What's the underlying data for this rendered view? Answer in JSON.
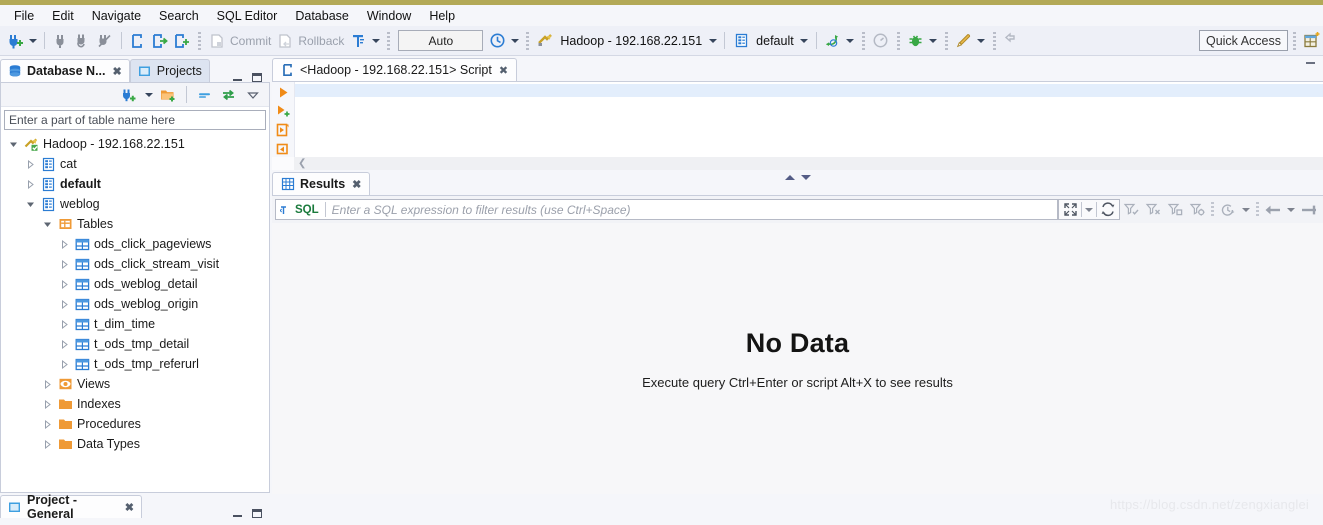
{
  "app": {
    "menu": [
      "File",
      "Edit",
      "Navigate",
      "Search",
      "SQL Editor",
      "Database",
      "Window",
      "Help"
    ]
  },
  "toolbar": {
    "commit_label": "Commit",
    "rollback_label": "Rollback",
    "commit_mode": "Auto",
    "connection": "Hadoop - 192.168.22.151",
    "schema": "default",
    "quick_access": "Quick Access",
    "icons": [
      "new-connection-icon",
      "connect-icon",
      "refresh-connection-icon",
      "disconnect-icon",
      "sql-editor-icon",
      "sql-editor-new-icon",
      "sql-editor-open-icon",
      "commit-icon",
      "rollback-icon",
      "transaction-mode-icon",
      "transaction-log-icon",
      "datasource-icon",
      "schema-icon",
      "sync-icon",
      "dashboard-icon",
      "debug-icon",
      "run-icon",
      "pointer-icon",
      "perspective-icon"
    ]
  },
  "left_panel": {
    "tabs": [
      {
        "label": "Database N...",
        "icon": "database-icon",
        "active": true,
        "closable": true
      },
      {
        "label": "Projects",
        "icon": "projects-icon",
        "active": false,
        "closable": false
      }
    ],
    "panel_toolbar_icons": [
      "new-connection-icon",
      "dropdown-arrow-icon",
      "new-folder-icon",
      "collapse-all-icon",
      "link-editor-icon",
      "view-menu-icon"
    ],
    "filter_placeholder": "Enter a part of table name here",
    "tree": [
      {
        "label": "Hadoop - 192.168.22.151",
        "depth": 0,
        "twist": "expanded",
        "icon": "connection-icon",
        "bold": false
      },
      {
        "label": "cat",
        "depth": 1,
        "twist": "collapsed",
        "icon": "schema-icon",
        "bold": false
      },
      {
        "label": "default",
        "depth": 1,
        "twist": "collapsed",
        "icon": "schema-icon",
        "bold": true
      },
      {
        "label": "weblog",
        "depth": 1,
        "twist": "expanded",
        "icon": "schema-icon",
        "bold": false
      },
      {
        "label": "Tables",
        "depth": 2,
        "twist": "expanded",
        "icon": "tables-folder-icon",
        "bold": false
      },
      {
        "label": "ods_click_pageviews",
        "depth": 3,
        "twist": "collapsed",
        "icon": "table-icon",
        "bold": false
      },
      {
        "label": "ods_click_stream_visit",
        "depth": 3,
        "twist": "collapsed",
        "icon": "table-icon",
        "bold": false
      },
      {
        "label": "ods_weblog_detail",
        "depth": 3,
        "twist": "collapsed",
        "icon": "table-icon",
        "bold": false
      },
      {
        "label": "ods_weblog_origin",
        "depth": 3,
        "twist": "collapsed",
        "icon": "table-icon",
        "bold": false
      },
      {
        "label": "t_dim_time",
        "depth": 3,
        "twist": "collapsed",
        "icon": "table-icon",
        "bold": false
      },
      {
        "label": "t_ods_tmp_detail",
        "depth": 3,
        "twist": "collapsed",
        "icon": "table-icon",
        "bold": false
      },
      {
        "label": "t_ods_tmp_referurl",
        "depth": 3,
        "twist": "collapsed",
        "icon": "table-icon",
        "bold": false
      },
      {
        "label": "Views",
        "depth": 2,
        "twist": "collapsed",
        "icon": "views-icon",
        "bold": false
      },
      {
        "label": "Indexes",
        "depth": 2,
        "twist": "collapsed",
        "icon": "folder-icon",
        "bold": false
      },
      {
        "label": "Procedures",
        "depth": 2,
        "twist": "collapsed",
        "icon": "folder-icon",
        "bold": false
      },
      {
        "label": "Data Types",
        "depth": 2,
        "twist": "collapsed",
        "icon": "folder-icon",
        "bold": false
      }
    ]
  },
  "editor": {
    "tab_label": "<Hadoop - 192.168.22.151> Script",
    "tab_icon": "sql-script-icon",
    "gutter_icons": [
      "execute-statement-icon",
      "execute-new-tab-icon",
      "execute-script-icon",
      "execute-expression-icon"
    ],
    "content": ""
  },
  "results": {
    "tab_label": "Results",
    "tab_icon": "grid-icon",
    "filter": {
      "prefix": "SQL",
      "prefix_icon": "sql-filter-icon",
      "placeholder": "Enter a SQL expression to filter results (use Ctrl+Space)",
      "value": ""
    },
    "toolbar_icons": [
      "maximize-icon",
      "dropdown-arrow-icon",
      "refresh-icon",
      "filter-apply-icon",
      "filter-remove-icon",
      "filter-save-icon",
      "filter-settings-icon",
      "history-icon",
      "history-dropdown-icon",
      "previous-icon",
      "nav-dropdown-icon",
      "next-icon"
    ],
    "empty_title": "No Data",
    "empty_subtitle": "Execute query Ctrl+Enter or script Alt+X to see results"
  },
  "bottom_panel": {
    "tab_label": "Project - General",
    "tab_icon": "project-icon"
  },
  "watermark": "https://blog.csdn.net/zengxianglei",
  "colors": {
    "accent_blue": "#2b7cd3",
    "orange": "#e8891a",
    "green": "#39a845",
    "title_strip": "#b3a957",
    "panel_bg": "#f5f6fa"
  }
}
